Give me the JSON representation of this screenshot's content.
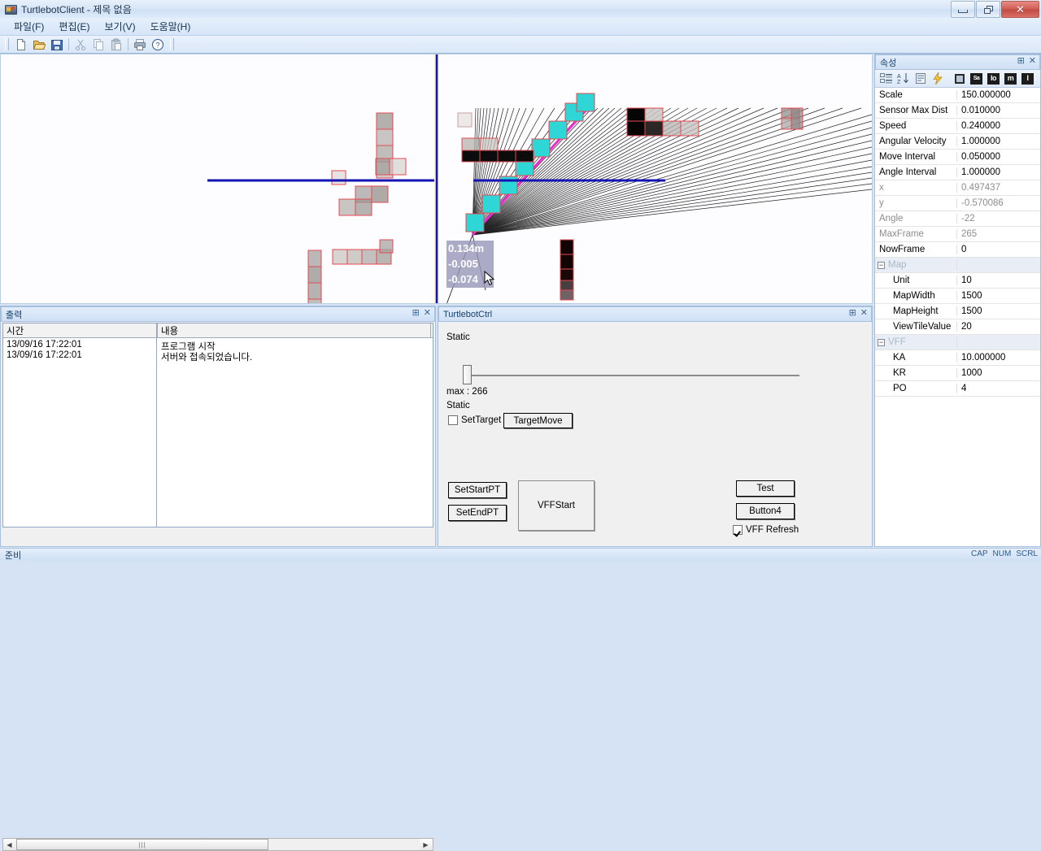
{
  "window": {
    "title": "TurtlebotClient - 제목 없음",
    "app_icon": "app-icon",
    "minimize": "minimize",
    "restore": "restore",
    "close": "✕"
  },
  "menubar": {
    "items": [
      {
        "label": "파일(F)",
        "name": "menu-file"
      },
      {
        "label": "편집(E)",
        "name": "menu-edit"
      },
      {
        "label": "보기(V)",
        "name": "menu-view"
      },
      {
        "label": "도움말(H)",
        "name": "menu-help"
      }
    ]
  },
  "toolbar": {
    "buttons": [
      {
        "name": "new-icon",
        "title": "New"
      },
      {
        "name": "open-icon",
        "title": "Open"
      },
      {
        "name": "save-icon",
        "title": "Save"
      },
      {
        "name": "cut-icon",
        "title": "Cut"
      },
      {
        "name": "copy-icon",
        "title": "Copy"
      },
      {
        "name": "paste-icon",
        "title": "Paste"
      },
      {
        "name": "print-icon",
        "title": "Print"
      },
      {
        "name": "help-icon",
        "title": "About"
      }
    ]
  },
  "map": {
    "readout": {
      "distance": "0.134m",
      "x": "-0.005",
      "y": "-0.074"
    },
    "axis_color": "#1414b4",
    "obstacle_outline": "#e24a52",
    "ray_highlight": "#ee2ad2",
    "scan_cell": "#2fd6d6",
    "hit_cell": "#000000"
  },
  "output_pane": {
    "title": "출력",
    "columns": [
      "시간",
      "내용"
    ],
    "rows": [
      [
        "13/09/16 17:22:01",
        "프로그램 시작"
      ],
      [
        "13/09/16 17:22:01",
        "서버와 접속되었습니다."
      ]
    ]
  },
  "ctrl_pane": {
    "title": "TurtlebotCtrl",
    "static_label_1": "Static",
    "slider_max_label": "max : 266",
    "static_label_2": "Static",
    "set_target_label": "SetTarget",
    "set_target_checked": false,
    "target_move_label": "TargetMove",
    "set_start_pt_label": "SetStartPT",
    "set_end_pt_label": "SetEndPT",
    "vff_start_label": "VFFStart",
    "test_label": "Test",
    "button4_label": "Button4",
    "vff_refresh_label": "VFF Refresh",
    "vff_refresh_checked": true
  },
  "properties": {
    "title": "속성",
    "tools": [
      {
        "name": "categorized-view-icon"
      },
      {
        "name": "alphabetical-sort-icon"
      },
      {
        "name": "property-pages-icon"
      },
      {
        "name": "events-icon"
      },
      {
        "name": "stop-icon"
      },
      {
        "name": "save-icon-dark",
        "text": "Sa"
      },
      {
        "name": "load-icon-dark",
        "text": "lo"
      },
      {
        "name": "map-icon-dark",
        "text": "m"
      },
      {
        "name": "info-icon-dark",
        "text": "I"
      }
    ],
    "rows": [
      {
        "name": "Scale",
        "value": "150.000000",
        "dim": false,
        "indent": false,
        "category": false
      },
      {
        "name": "Sensor Max Dist",
        "value": "0.010000",
        "dim": false,
        "indent": false,
        "category": false
      },
      {
        "name": "Speed",
        "value": "0.240000",
        "dim": false,
        "indent": false,
        "category": false
      },
      {
        "name": "Angular Velocity",
        "value": "1.000000",
        "dim": false,
        "indent": false,
        "category": false
      },
      {
        "name": "Move Interval",
        "value": "0.050000",
        "dim": false,
        "indent": false,
        "category": false
      },
      {
        "name": "Angle Interval",
        "value": "1.000000",
        "dim": false,
        "indent": false,
        "category": false
      },
      {
        "name": "x",
        "value": "0.497437",
        "dim": true,
        "indent": false,
        "category": false
      },
      {
        "name": "y",
        "value": "-0.570086",
        "dim": true,
        "indent": false,
        "category": false
      },
      {
        "name": "Angle",
        "value": "-22",
        "dim": true,
        "indent": false,
        "category": false
      },
      {
        "name": "MaxFrame",
        "value": "265",
        "dim": true,
        "indent": false,
        "category": false
      },
      {
        "name": "NowFrame",
        "value": "0",
        "dim": false,
        "indent": false,
        "category": false
      },
      {
        "name": "Map",
        "value": "",
        "dim": true,
        "indent": false,
        "category": true
      },
      {
        "name": "Unit",
        "value": "10",
        "dim": false,
        "indent": true,
        "category": false
      },
      {
        "name": "MapWidth",
        "value": "1500",
        "dim": false,
        "indent": true,
        "category": false
      },
      {
        "name": "MapHeight",
        "value": "1500",
        "dim": false,
        "indent": true,
        "category": false
      },
      {
        "name": "ViewTileValue",
        "value": "20",
        "dim": false,
        "indent": true,
        "category": false
      },
      {
        "name": "VFF",
        "value": "",
        "dim": true,
        "indent": false,
        "category": true
      },
      {
        "name": "KA",
        "value": "10.000000",
        "dim": false,
        "indent": true,
        "category": false
      },
      {
        "name": "KR",
        "value": "1000",
        "dim": false,
        "indent": true,
        "category": false
      },
      {
        "name": "PO",
        "value": "4",
        "dim": false,
        "indent": true,
        "category": false
      }
    ]
  },
  "statusbar": {
    "text": "준비",
    "indicators": [
      "CAP",
      "NUM",
      "SCRL"
    ]
  },
  "pane_buttons": {
    "pin": "⊞",
    "close": "✕"
  }
}
